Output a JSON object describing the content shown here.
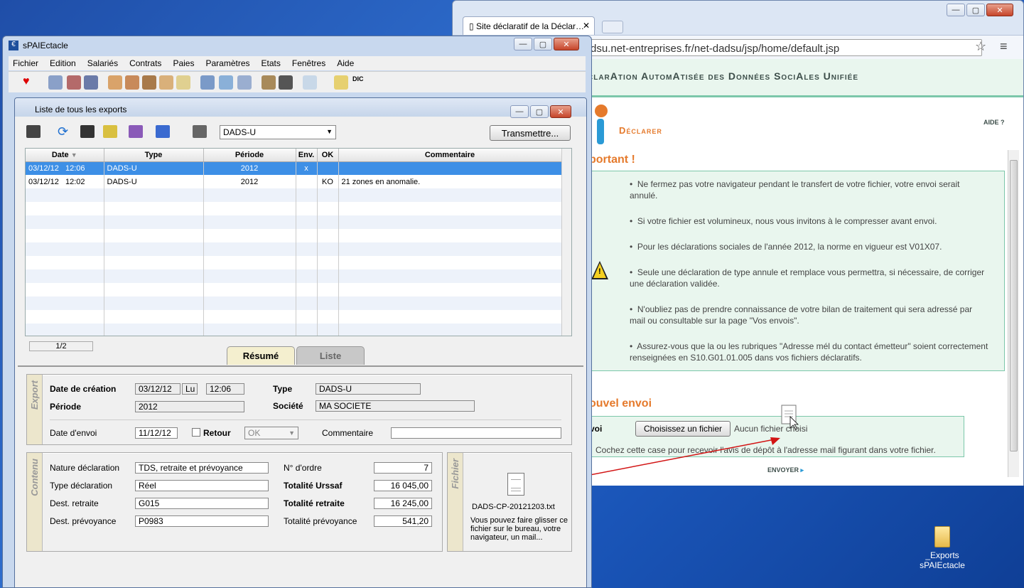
{
  "browser": {
    "tab_title": "Site déclaratif de la Déclar…",
    "url": "dsu.net-entreprises.fr/net-dadsu/jsp/home/default.jsp",
    "header": "clarAtion AutomAtisée des Données SociAles Unifiée",
    "declarer": "Déclarer",
    "aide": "AIDE ?",
    "important": "portant !",
    "notes": [
      "Ne fermez pas votre navigateur pendant le transfert de votre fichier, votre envoi serait annulé.",
      "Si votre fichier est volumineux, nous vous invitons à le compresser avant envoi.",
      "Pour les déclarations sociales de l'année 2012, la norme en vigueur est V01X07.",
      "Seule une déclaration de type annule et remplace vous permettra, si nécessaire, de corriger une déclaration validée.",
      "N'oubliez pas de prendre connaissance de votre bilan de traitement qui sera adressé par mail ou consultable sur la page \"Vos envois\".",
      "Assurez-vous que la ou les rubriques \"Adresse mél du contact émetteur\" soient correctement renseignées en S10.G01.01.005 dans vos fichiers déclaratifs."
    ],
    "nouvel_envoi": "ouvel envoi",
    "envoi_label": "voi",
    "choose_button": "Choisissez un fichier",
    "no_file": "Aucun fichier choisi",
    "checkbox_text": "Cochez cette case pour recevoir l'avis de dépôt à l'adresse mail figurant dans votre fichier.",
    "envoyer": "ENVOYER"
  },
  "app": {
    "title": "sPAIEctacle",
    "menu": [
      "Fichier",
      "Edition",
      "Salariés",
      "Contrats",
      "Paies",
      "Paramètres",
      "Etats",
      "Fenêtres",
      "Aide"
    ],
    "inner_title": "Liste de tous les exports",
    "export_type_select": "DADS-U",
    "transmit_button": "Transmettre...",
    "columns": [
      "Date",
      "Type",
      "Période",
      "Env.",
      "OK",
      "Commentaire"
    ],
    "rows": [
      {
        "date": "03/12/12",
        "time": "12:06",
        "type": "DADS-U",
        "periode": "2012",
        "env": "x",
        "ok": "",
        "comment": ""
      },
      {
        "date": "03/12/12",
        "time": "12:02",
        "type": "DADS-U",
        "periode": "2012",
        "env": "",
        "ok": "KO",
        "comment": "21 zones en anomalie."
      }
    ],
    "pager": "1/2",
    "tabs": {
      "resume": "Résumé",
      "liste": "Liste"
    },
    "export": {
      "section": "Export",
      "date_creation_label": "Date de création",
      "date_creation": "03/12/12",
      "day": "Lu",
      "time": "12:06",
      "type_label": "Type",
      "type": "DADS-U",
      "periode_label": "Période",
      "periode": "2012",
      "societe_label": "Société",
      "societe": "MA SOCIETE",
      "date_envoi_label": "Date d'envoi",
      "date_envoi": "11/12/12",
      "retour_label": "Retour",
      "status": "OK",
      "commentaire_label": "Commentaire",
      "commentaire": ""
    },
    "contenu": {
      "section": "Contenu",
      "nature_label": "Nature déclaration",
      "nature": "TDS, retraite et prévoyance",
      "type_label": "Type déclaration",
      "type": "Réel",
      "retraite_label": "Dest. retraite",
      "retraite": "G015",
      "prevoyance_label": "Dest. prévoyance",
      "prevoyance": "P0983",
      "ordre_label": "N° d'ordre",
      "ordre": "7",
      "urssaf_label": "Totalité Urssaf",
      "urssaf": "16 045,00",
      "tot_retraite_label": "Totalité retraite",
      "tot_retraite": "16 245,00",
      "tot_prevoyance_label": "Totalité prévoyance",
      "tot_prevoyance": "541,20"
    },
    "fichier": {
      "section": "Fichier",
      "filename": "DADS-CP-20121203.txt",
      "hint": "Vous pouvez faire glisser ce fichier sur le bureau, votre navigateur, un mail..."
    }
  },
  "desktop": {
    "icon_label_1": "_Exports",
    "icon_label_2": "sPAIEctacle"
  },
  "colors": {
    "accent": "#3d8fe6",
    "dads_green": "#7cc7aa",
    "dads_orange": "#e57a2c",
    "arrow": "#d21414"
  }
}
